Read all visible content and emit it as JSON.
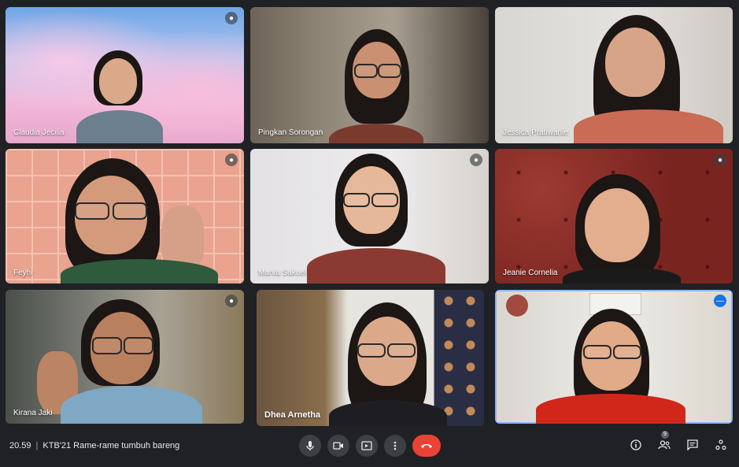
{
  "participants": [
    {
      "name": "Claudia Jecilia",
      "pin_icon": "mic-icon"
    },
    {
      "name": "Pingkan Sorongan"
    },
    {
      "name": "Jessica Pratiwanie"
    },
    {
      "name": "Feyhi",
      "pin_icon": "mic-icon"
    },
    {
      "name": "Marva Sakuel",
      "pin_icon": "mic-icon"
    },
    {
      "name": "Jeanie Cornelia",
      "pin_icon": "mic-icon"
    },
    {
      "name": "Kirana Jaki",
      "pin_icon": "mic-icon"
    },
    {
      "name": "Dhea Arnetha"
    },
    {
      "name": "",
      "pin_icon": "more-options-icon"
    }
  ],
  "bottom": {
    "time": "20.59",
    "separator": "|",
    "meeting_title": "KTB'21 Rame-rame tumbuh bareng",
    "participant_count": "9"
  },
  "colors": {
    "background": "#202124",
    "end_call": "#ea4335",
    "active_border": "#8ab4f8"
  }
}
